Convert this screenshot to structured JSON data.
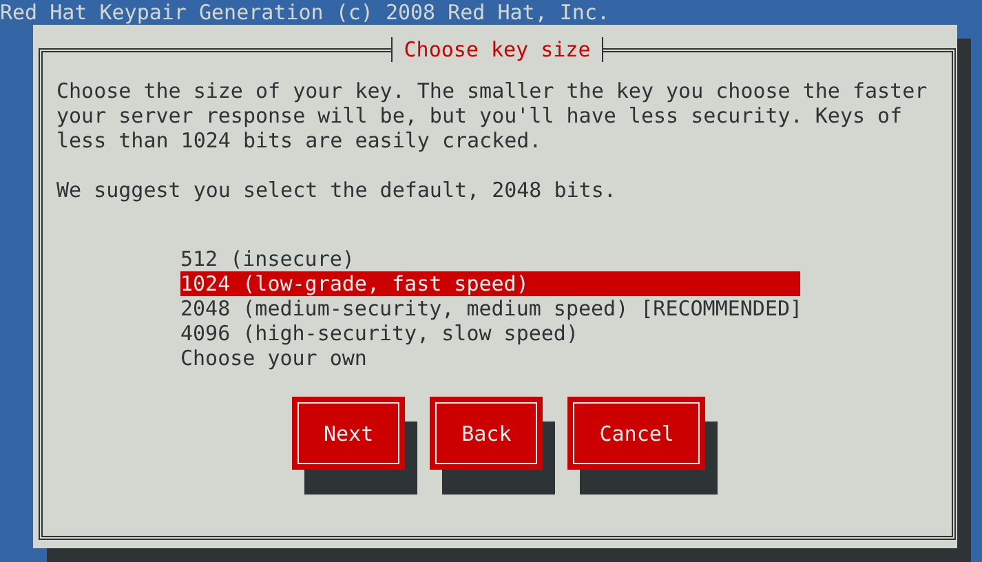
{
  "screen_title": "Red Hat Keypair Generation (c) 2008 Red Hat, Inc.",
  "dialog": {
    "title": "Choose key size",
    "paragraphs": [
      "Choose the size of your key. The smaller the key you choose the faster your server response will be, but you'll have less security. Keys of less than 1024 bits are easily cracked.",
      "We suggest you select the default, 2048 bits."
    ],
    "options": [
      {
        "label": "512 (insecure)",
        "selected": false
      },
      {
        "label": "1024 (low-grade, fast speed)",
        "selected": true
      },
      {
        "label": "2048 (medium-security, medium speed) [RECOMMENDED]",
        "selected": false
      },
      {
        "label": "4096 (high-security, slow speed)",
        "selected": false
      },
      {
        "label": "Choose your own",
        "selected": false
      }
    ],
    "buttons": [
      "Next",
      "Back",
      "Cancel"
    ]
  }
}
